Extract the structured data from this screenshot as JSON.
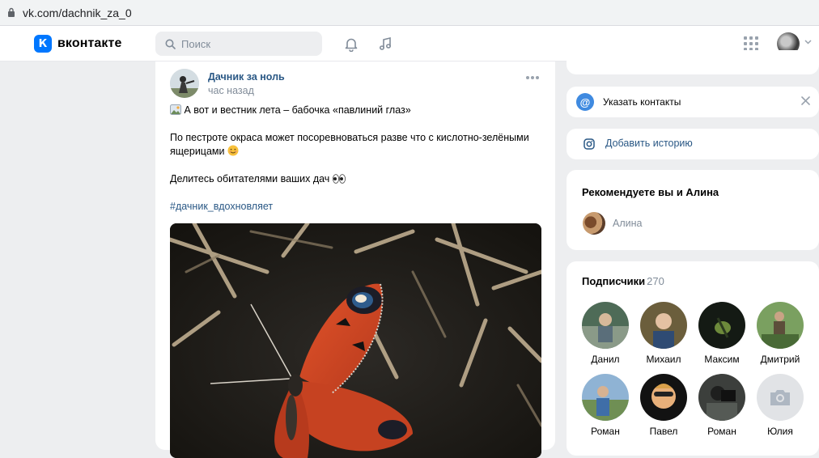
{
  "browser": {
    "url": "vk.com/dachnik_za_0"
  },
  "header": {
    "logo_text": "вконтакте",
    "search_placeholder": "Поиск"
  },
  "post": {
    "author": "Дачник за ноль",
    "time": "час назад",
    "line1": "А вот и вестник лета – бабочка «павлиний глаз»",
    "line2": "По пестроте окраса может посоревноваться разве что с кислотно-зелёными ящерицами",
    "line3": "Делитесь обитателями ваших дач",
    "hashtag": "#дачник_вдохновляет"
  },
  "sidebar": {
    "contacts_label": "Указать контакты",
    "story_label": "Добавить историю",
    "recommend_title": "Рекомендуете вы и Алина",
    "recommend_name": "Алина",
    "subscribers_title": "Подписчики",
    "subscribers_count": "270",
    "subscribers": [
      {
        "name": "Данил"
      },
      {
        "name": "Михаил"
      },
      {
        "name": "Максим"
      },
      {
        "name": "Дмитрий"
      },
      {
        "name": "Роман"
      },
      {
        "name": "Павел"
      },
      {
        "name": "Роман"
      },
      {
        "name": "Юлия"
      }
    ]
  },
  "colors": {
    "accent": "#0077ff",
    "link": "#2a5885",
    "secondary_text": "#818c99",
    "page_bg": "#edeef0"
  }
}
